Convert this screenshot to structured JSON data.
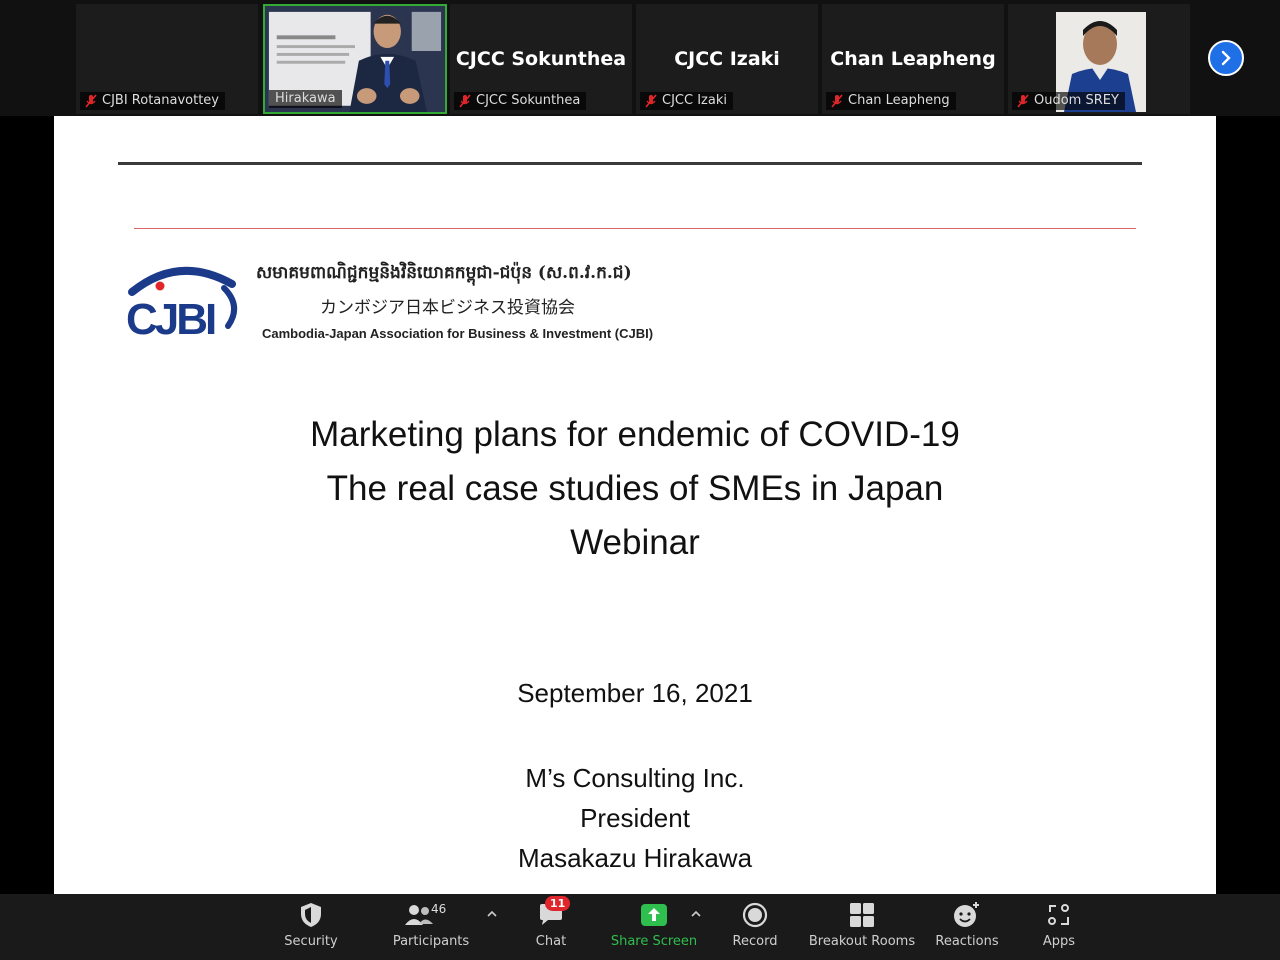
{
  "participants": [
    {
      "name": "CJBI Rotanavottey",
      "display": "",
      "muted": true,
      "video": false
    },
    {
      "name": "Hirakawa",
      "display": "",
      "muted": false,
      "video": true
    },
    {
      "name": "CJCC Sokunthea",
      "display": "CJCC Sokunthea",
      "muted": true,
      "video": false
    },
    {
      "name": "CJCC Izaki",
      "display": "CJCC Izaki",
      "muted": true,
      "video": false
    },
    {
      "name": "Chan Leapheng",
      "display": "Chan Leapheng",
      "muted": true,
      "video": false
    },
    {
      "name": "Oudom SREY",
      "display": "",
      "muted": true,
      "video": true
    }
  ],
  "slide": {
    "org_khmer": "សមាគមពាណិជ្ជកម្មនិងវិនិយោគកម្ពុជា-ជប៉ុន (ស.ព.វ.ក.ជ)",
    "org_japanese": "カンボジア日本ビジネス投資協会",
    "org_english": "Cambodia-Japan Association for Business & Investment (CJBI)",
    "logo_text": "CJBI",
    "title_lines": [
      "Marketing plans for endemic of COVID-19",
      "The real case studies of SMEs in Japan",
      "Webinar"
    ],
    "date": "September 16, 2021",
    "presenter_lines": [
      "M’s Consulting Inc.",
      "President",
      "Masakazu Hirakawa"
    ]
  },
  "toolbar": {
    "security": "Security",
    "participants": "Participants",
    "participant_count": "46",
    "chat": "Chat",
    "chat_badge": "11",
    "share_screen": "Share Screen",
    "record": "Record",
    "breakout_rooms": "Breakout Rooms",
    "reactions": "Reactions",
    "apps": "Apps"
  },
  "colors": {
    "accent_blue": "#1f6fe6",
    "share_green": "#2fbf4f",
    "mute_red": "#e0262b",
    "logo_navy": "#1b3a8a"
  }
}
